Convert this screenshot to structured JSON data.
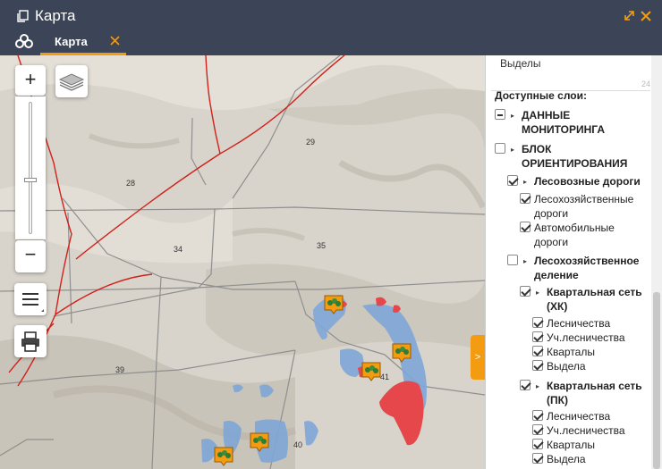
{
  "window": {
    "title": "Карта",
    "tab_label": "Карта"
  },
  "map": {
    "zoom_in_label": "+",
    "zoom_out_label": "−",
    "labels": [
      "29",
      "28",
      "34",
      "35",
      "39",
      "41",
      "40"
    ]
  },
  "panel": {
    "field_label": "Выделы",
    "field_counter": "24",
    "section_title": "Доступные слои:",
    "toggle_label": ">",
    "layers": [
      {
        "label": "ДАННЫЕ МОНИТОРИНГА",
        "state": "partial",
        "bold": true,
        "arrow": true
      },
      {
        "label": "БЛОК ОРИЕНТИРОВАНИЯ",
        "state": "unchecked",
        "bold": true,
        "arrow": true
      },
      {
        "label": "Лесовозные дороги",
        "state": "checked",
        "bold": true,
        "arrow": true
      },
      {
        "label": "Лесохозяйственные дороги",
        "state": "checked",
        "bold": false,
        "arrow": false
      },
      {
        "label": "Автомобильные дороги",
        "state": "checked",
        "bold": false,
        "arrow": false
      },
      {
        "label": "Лесохозяйственное деление",
        "state": "unchecked",
        "bold": true,
        "arrow": true
      },
      {
        "label": "Квартальная сеть (ХК)",
        "state": "checked",
        "bold": true,
        "arrow": true
      },
      {
        "label": "Лесничества",
        "state": "checked",
        "bold": false,
        "arrow": false
      },
      {
        "label": "Уч.лесничества",
        "state": "checked",
        "bold": false,
        "arrow": false
      },
      {
        "label": "Кварталы",
        "state": "checked",
        "bold": false,
        "arrow": false
      },
      {
        "label": "Выдела",
        "state": "checked",
        "bold": false,
        "arrow": false
      },
      {
        "label": "Квартальная сеть (ПК)",
        "state": "checked",
        "bold": true,
        "arrow": true
      },
      {
        "label": "Лесничества",
        "state": "checked",
        "bold": false,
        "arrow": false
      },
      {
        "label": "Уч.лесничества",
        "state": "checked",
        "bold": false,
        "arrow": false
      },
      {
        "label": "Кварталы",
        "state": "checked",
        "bold": false,
        "arrow": false
      },
      {
        "label": "Выдела",
        "state": "checked",
        "bold": false,
        "arrow": false
      }
    ]
  }
}
